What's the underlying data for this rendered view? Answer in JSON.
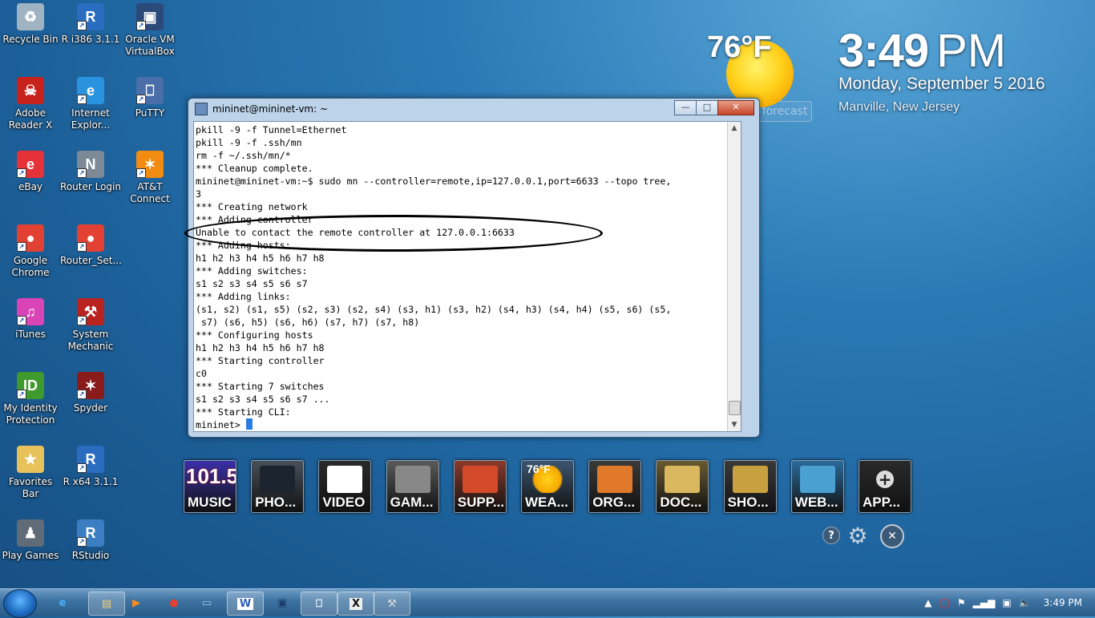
{
  "desktop": {
    "icons": [
      {
        "label": "Recycle Bin",
        "icon": "recycle-bin-icon"
      },
      {
        "label": "R i386 3.1.1",
        "icon": "r-icon"
      },
      {
        "label": "Oracle VM VirtualBox",
        "icon": "virtualbox-icon"
      },
      {
        "label": "Adobe Reader X",
        "icon": "adobe-reader-icon"
      },
      {
        "label": "Internet Explor...",
        "icon": "internet-explorer-icon"
      },
      {
        "label": "PuTTY",
        "icon": "putty-icon"
      },
      {
        "label": "eBay",
        "icon": "ebay-icon"
      },
      {
        "label": "Router Login",
        "icon": "router-icon"
      },
      {
        "label": "AT&T Connect",
        "icon": "att-connect-icon"
      },
      {
        "label": "Google Chrome",
        "icon": "chrome-icon"
      },
      {
        "label": "Router_Set...",
        "icon": "chrome-icon"
      },
      {
        "label": "iTunes",
        "icon": "itunes-icon"
      },
      {
        "label": "System Mechanic",
        "icon": "system-mechanic-icon"
      },
      {
        "label": "My Identity Protection",
        "icon": "identity-protection-icon"
      },
      {
        "label": "Spyder",
        "icon": "spyder-icon"
      },
      {
        "label": "Favorites Bar",
        "icon": "folder-icon"
      },
      {
        "label": "R x64 3.1.1",
        "icon": "r-icon"
      },
      {
        "label": "Play Games",
        "icon": "games-icon"
      },
      {
        "label": "RStudio",
        "icon": "rstudio-icon"
      }
    ]
  },
  "weather": {
    "temp": "76°F",
    "forecast_label": "forecast"
  },
  "clock": {
    "time": "3:49",
    "ampm": "PM",
    "date": "Monday, September 5 2016",
    "location": "Manville, New Jersey"
  },
  "terminal": {
    "title": "mininet@mininet-vm: ~",
    "lines": [
      "pkill -9 -f Tunnel=Ethernet",
      "pkill -9 -f .ssh/mn",
      "rm -f ~/.ssh/mn/*",
      "*** Cleanup complete.",
      "mininet@mininet-vm:~$ sudo mn --controller=remote,ip=127.0.0.1,port=6633 --topo tree,",
      "3",
      "*** Creating network",
      "*** Adding controller",
      "Unable to contact the remote controller at 127.0.0.1:6633",
      "*** Adding hosts:",
      "h1 h2 h3 h4 h5 h6 h7 h8",
      "*** Adding switches:",
      "s1 s2 s3 s4 s5 s6 s7",
      "*** Adding links:",
      "(s1, s2) (s1, s5) (s2, s3) (s2, s4) (s3, h1) (s3, h2) (s4, h3) (s4, h4) (s5, s6) (s5,",
      " s7) (s6, h5) (s6, h6) (s7, h7) (s7, h8)",
      "*** Configuring hosts",
      "h1 h2 h3 h4 h5 h6 h7 h8",
      "*** Starting controller",
      "c0",
      "*** Starting 7 switches",
      "s1 s2 s3 s4 s5 s6 s7 ...",
      "*** Starting CLI:"
    ],
    "prompt": "mininet> "
  },
  "tiles": [
    {
      "label": "MUSIC",
      "art": "101.5"
    },
    {
      "label": "PHO...",
      "art": ""
    },
    {
      "label": "VIDEO",
      "art": ""
    },
    {
      "label": "GAM...",
      "art": ""
    },
    {
      "label": "SUPP...",
      "art": ""
    },
    {
      "label": "WEA...",
      "art": "76°F"
    },
    {
      "label": "ORG...",
      "art": ""
    },
    {
      "label": "DOC...",
      "art": ""
    },
    {
      "label": "SHO...",
      "art": ""
    },
    {
      "label": "WEB...",
      "art": ""
    },
    {
      "label": "APP...",
      "art": ""
    }
  ],
  "dock_controls": {
    "help": "?",
    "settings_icon": "gear-icon",
    "close": "✕"
  },
  "taskbar": {
    "apps": [
      "internet-explorer-icon",
      "file-explorer-icon",
      "media-player-icon",
      "chrome-icon",
      "remote-desktop-icon",
      "word-icon",
      "virtualbox-icon",
      "putty-icon",
      "xming-icon",
      "system-mechanic-icon"
    ],
    "word_letter": "W",
    "x_letter": "X",
    "tray_time": "3:49 PM"
  }
}
